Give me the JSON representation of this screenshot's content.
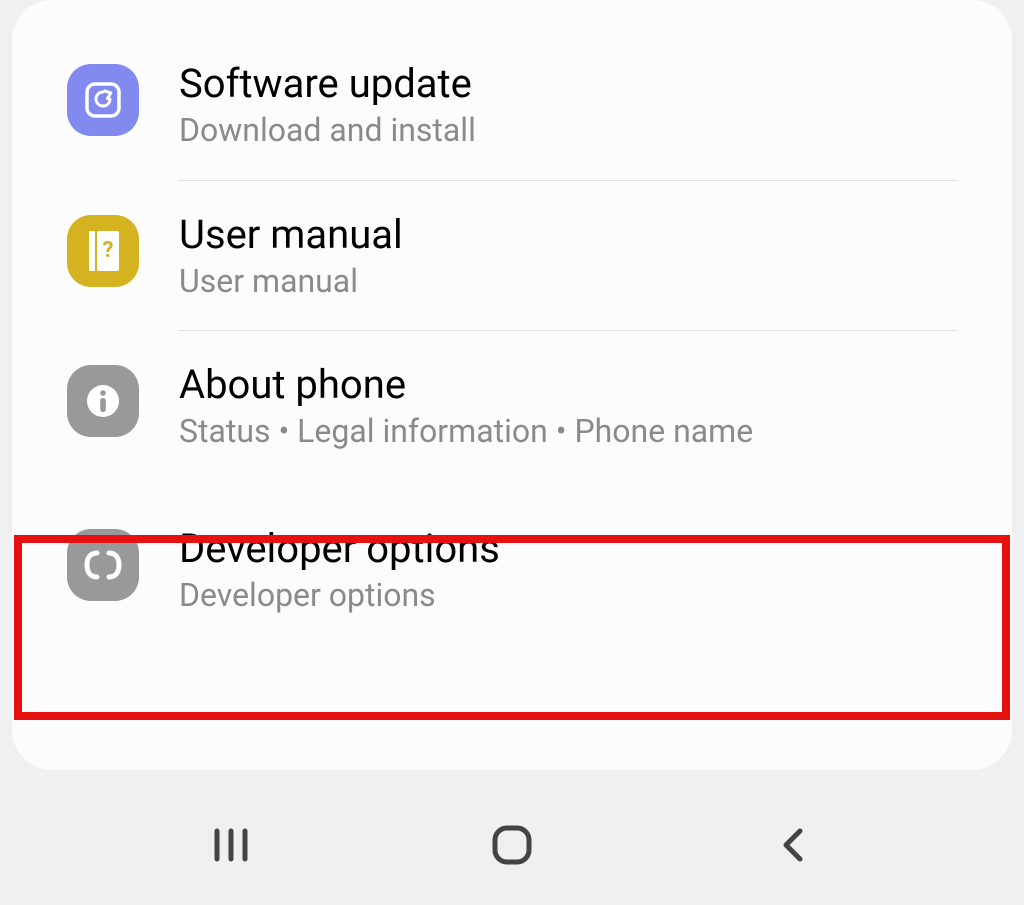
{
  "settings": {
    "items": [
      {
        "title": "Software update",
        "subtitle": "Download and install",
        "icon": "update-icon",
        "iconColor": "purple"
      },
      {
        "title": "User manual",
        "subtitle": "User manual",
        "icon": "manual-icon",
        "iconColor": "yellow"
      },
      {
        "title": "About phone",
        "subtitle": "Status  •  Legal information  •  Phone name",
        "icon": "info-icon",
        "iconColor": "gray"
      },
      {
        "title": "Developer options",
        "subtitle": "Developer options",
        "icon": "developer-icon",
        "iconColor": "gray"
      }
    ]
  },
  "highlightedIndex": 3
}
